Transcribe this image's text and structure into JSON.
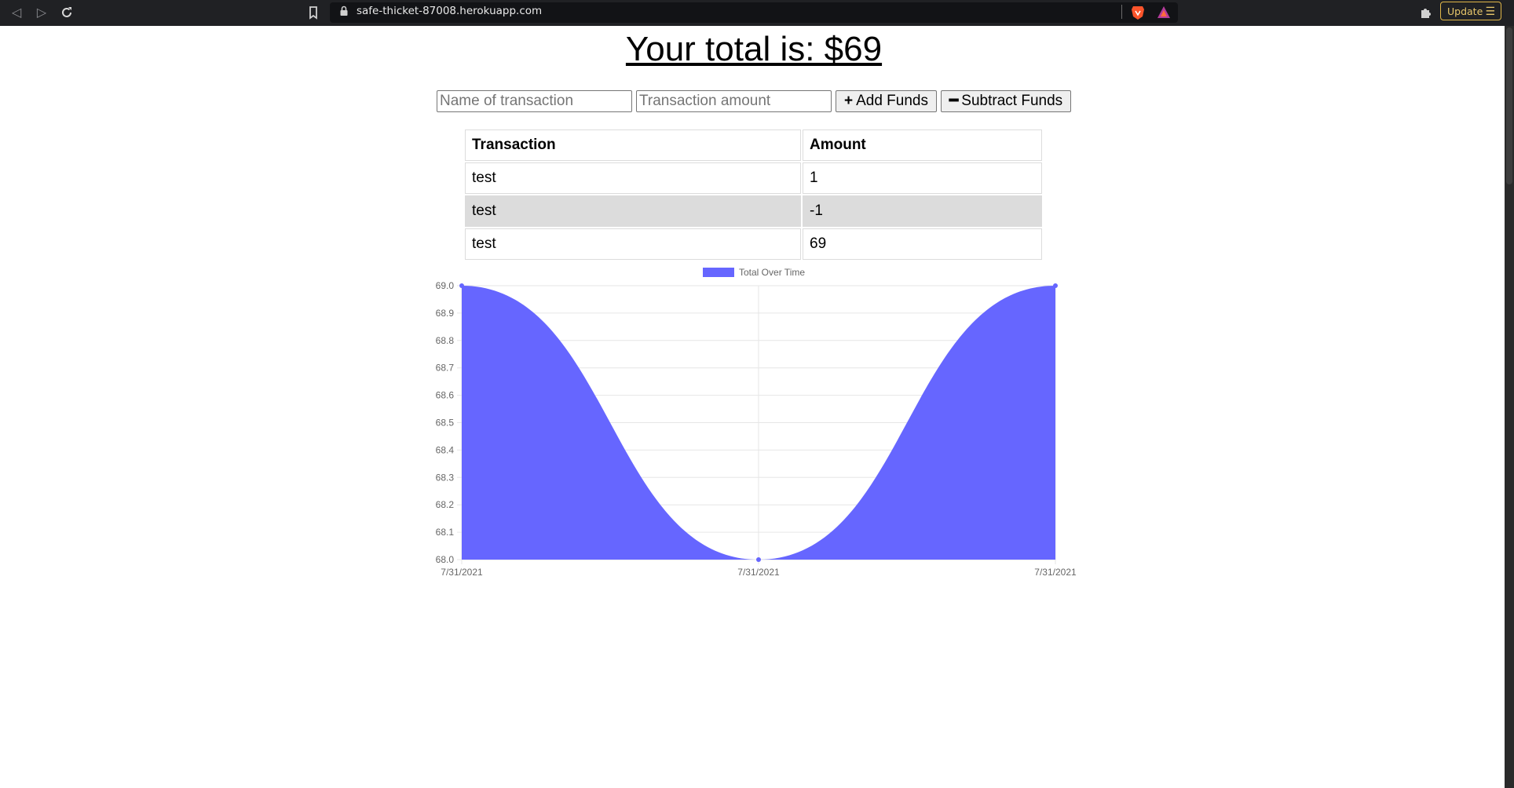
{
  "browser": {
    "url": "safe-thicket-87008.herokuapp.com",
    "update_label": "Update",
    "update_menu_icon": "☰"
  },
  "page": {
    "title": "Your total is: $69",
    "name_placeholder": "Name of transaction",
    "amount_placeholder": "Transaction amount",
    "add_label": "Add Funds",
    "add_icon": "+",
    "subtract_label": "Subtract Funds",
    "subtract_icon": "━"
  },
  "table": {
    "headers": [
      "Transaction",
      "Amount"
    ],
    "rows": [
      [
        "test",
        "1"
      ],
      [
        "test",
        "-1"
      ],
      [
        "test",
        "69"
      ]
    ]
  },
  "chart_data": {
    "type": "area",
    "title": "",
    "legend": "Total Over Time",
    "legend_position": "top-center",
    "color": "#6666ff",
    "x": [
      "7/31/2021",
      "7/31/2021",
      "7/31/2021"
    ],
    "series": [
      {
        "name": "Total Over Time",
        "values": [
          69,
          68,
          69
        ]
      }
    ],
    "ylim": [
      68.0,
      69.0
    ],
    "yticks": [
      "69.0",
      "68.9",
      "68.8",
      "68.7",
      "68.6",
      "68.5",
      "68.4",
      "68.3",
      "68.2",
      "68.1",
      "68.0"
    ],
    "grid": true
  }
}
